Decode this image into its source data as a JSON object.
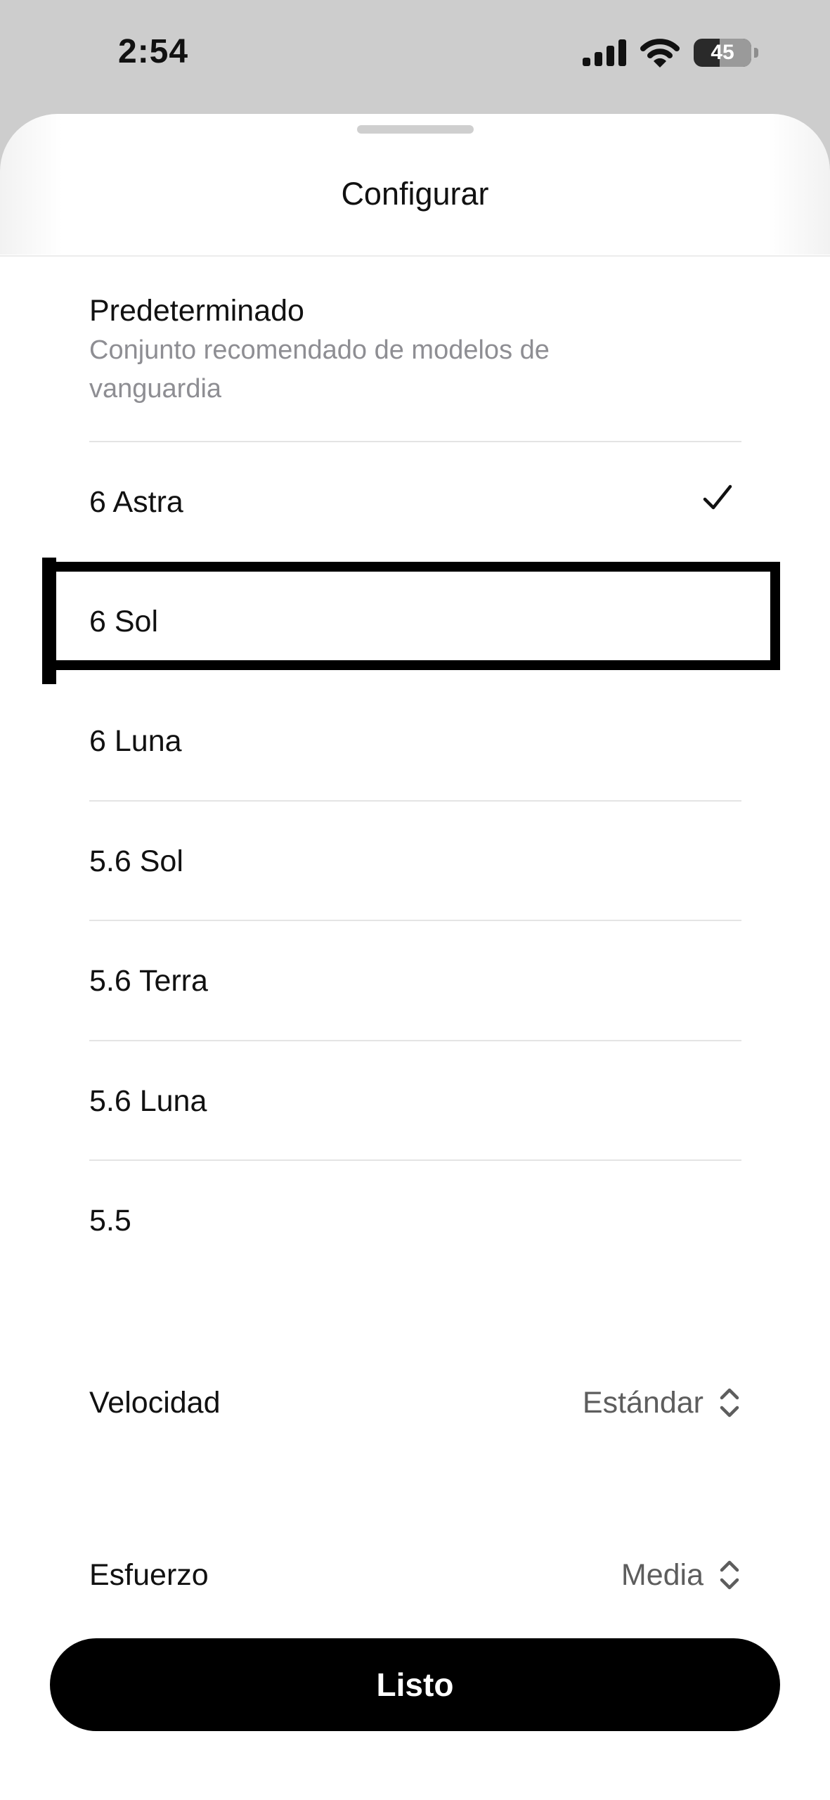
{
  "status_bar": {
    "time": "2:54",
    "battery_level": "45",
    "battery_fraction": 0.45,
    "icons": [
      "cellular-signal-icon",
      "wifi-icon",
      "battery-icon"
    ]
  },
  "sheet": {
    "title": "Configurar"
  },
  "options": [
    {
      "label": "Predeterminado",
      "description": "Conjunto recomendado de modelos de vanguardia",
      "selected": false
    },
    {
      "label": "6 Astra",
      "selected": true
    },
    {
      "label": "6 Sol",
      "selected": false,
      "highlighted": true
    },
    {
      "label": "6 Luna",
      "selected": false
    },
    {
      "label": "5.6 Sol",
      "selected": false
    },
    {
      "label": "5.6 Terra",
      "selected": false
    },
    {
      "label": "5.6 Luna",
      "selected": false
    },
    {
      "label": "5.5",
      "selected": false
    }
  ],
  "settings": {
    "speed": {
      "label": "Velocidad",
      "value": "Estándar"
    },
    "effort": {
      "label": "Esfuerzo",
      "value": "Media"
    }
  },
  "done_button": {
    "label": "Listo"
  },
  "colors": {
    "background_dim": "#cdcdcd",
    "sheet": "#ffffff",
    "primary_text": "#111111",
    "secondary_text": "#8e8e93",
    "button": "#000000",
    "button_text": "#ffffff",
    "highlight_frame": "#000000"
  }
}
